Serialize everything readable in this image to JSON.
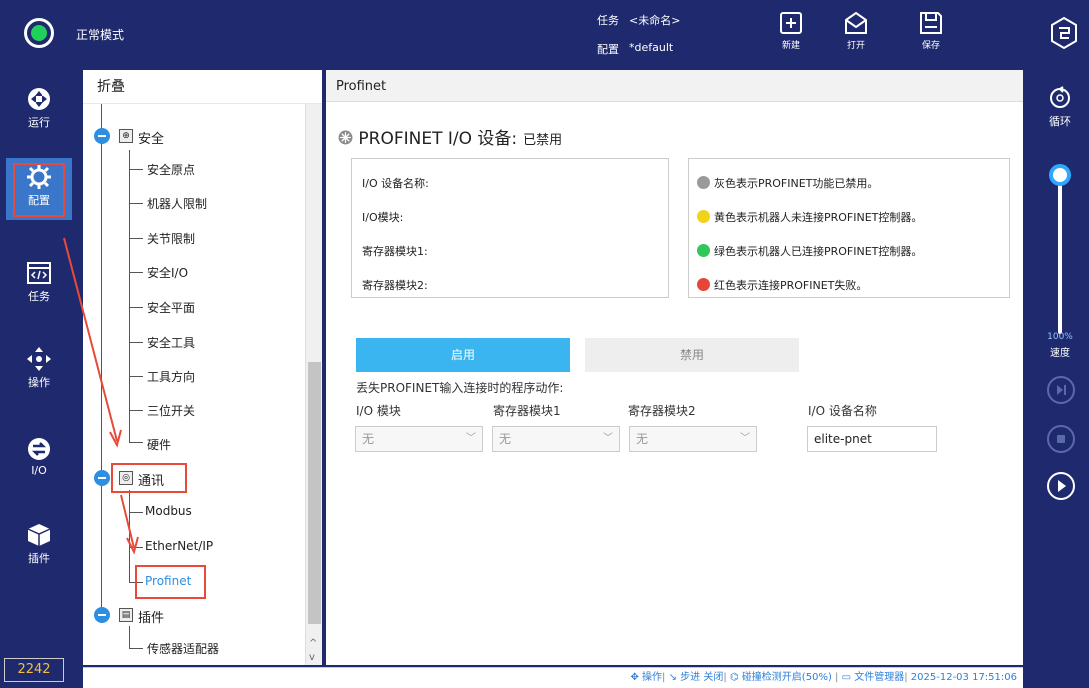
{
  "topbar": {
    "mode": "正常模式",
    "task_label": "任务",
    "task_value": "<未命名>",
    "config_label": "配置",
    "config_value": "*default",
    "new_label": "新建",
    "open_label": "打开",
    "save_label": "保存"
  },
  "leftnav": {
    "items": [
      {
        "label": "运行",
        "icon": "run-icon"
      },
      {
        "label": "配置",
        "icon": "gear-icon"
      },
      {
        "label": "任务",
        "icon": "code-icon"
      },
      {
        "label": "操作",
        "icon": "move-icon"
      },
      {
        "label": "I/O",
        "icon": "io-icon"
      },
      {
        "label": "插件",
        "icon": "plugin-icon"
      }
    ],
    "active": "配置",
    "counter": "2242"
  },
  "rightbar": {
    "loop_label": "循环",
    "speed_value": "100%",
    "speed_label": "速度"
  },
  "tree": {
    "header": "折叠",
    "groups": [
      {
        "label": "安全",
        "icon": "shield-icon",
        "children": [
          "安全原点",
          "机器人限制",
          "关节限制",
          "安全I/O",
          "安全平面",
          "安全工具",
          "工具方向",
          "三位开关",
          "硬件"
        ]
      },
      {
        "label": "通讯",
        "icon": "wifi-icon",
        "children": [
          "Modbus",
          "EtherNet/IP",
          "Profinet"
        ]
      },
      {
        "label": "插件",
        "icon": "plugin-icon",
        "children": [
          "传感器适配器"
        ]
      }
    ],
    "selected": "Profinet"
  },
  "content": {
    "header": "Profinet",
    "title": "PROFINET I/O 设备:",
    "status": "已禁用",
    "info_labels": [
      "I/O 设备名称:",
      "I/O模块:",
      "寄存器模块1:",
      "寄存器模块2:"
    ],
    "legend": [
      {
        "text": "灰色表示PROFINET功能已禁用。",
        "color": "#9a9a9a"
      },
      {
        "text": "黄色表示机器人未连接PROFINET控制器。",
        "color": "#f3d21a"
      },
      {
        "text": "绿色表示机器人已连接PROFINET控制器。",
        "color": "#2fc65a"
      },
      {
        "text": "红色表示连接PROFINET失败。",
        "color": "#e8453a"
      }
    ],
    "enable_label": "启用",
    "disable_label": "禁用",
    "lost_action_label": "丢失PROFINET输入连接时的程序动作:",
    "col_io_module": "I/O 模块",
    "col_reg1": "寄存器模块1",
    "col_reg2": "寄存器模块2",
    "col_device_name": "I/O 设备名称",
    "io_module_value": "无",
    "reg1_value": "无",
    "reg2_value": "无",
    "device_name_value": "elite-pnet"
  },
  "statusbar": {
    "op": "操作",
    "step": "步进 关闭",
    "collision": "碰撞检测开启(50%)",
    "files": "文件管理器",
    "datetime": "2025-12-03 17:51:06"
  }
}
